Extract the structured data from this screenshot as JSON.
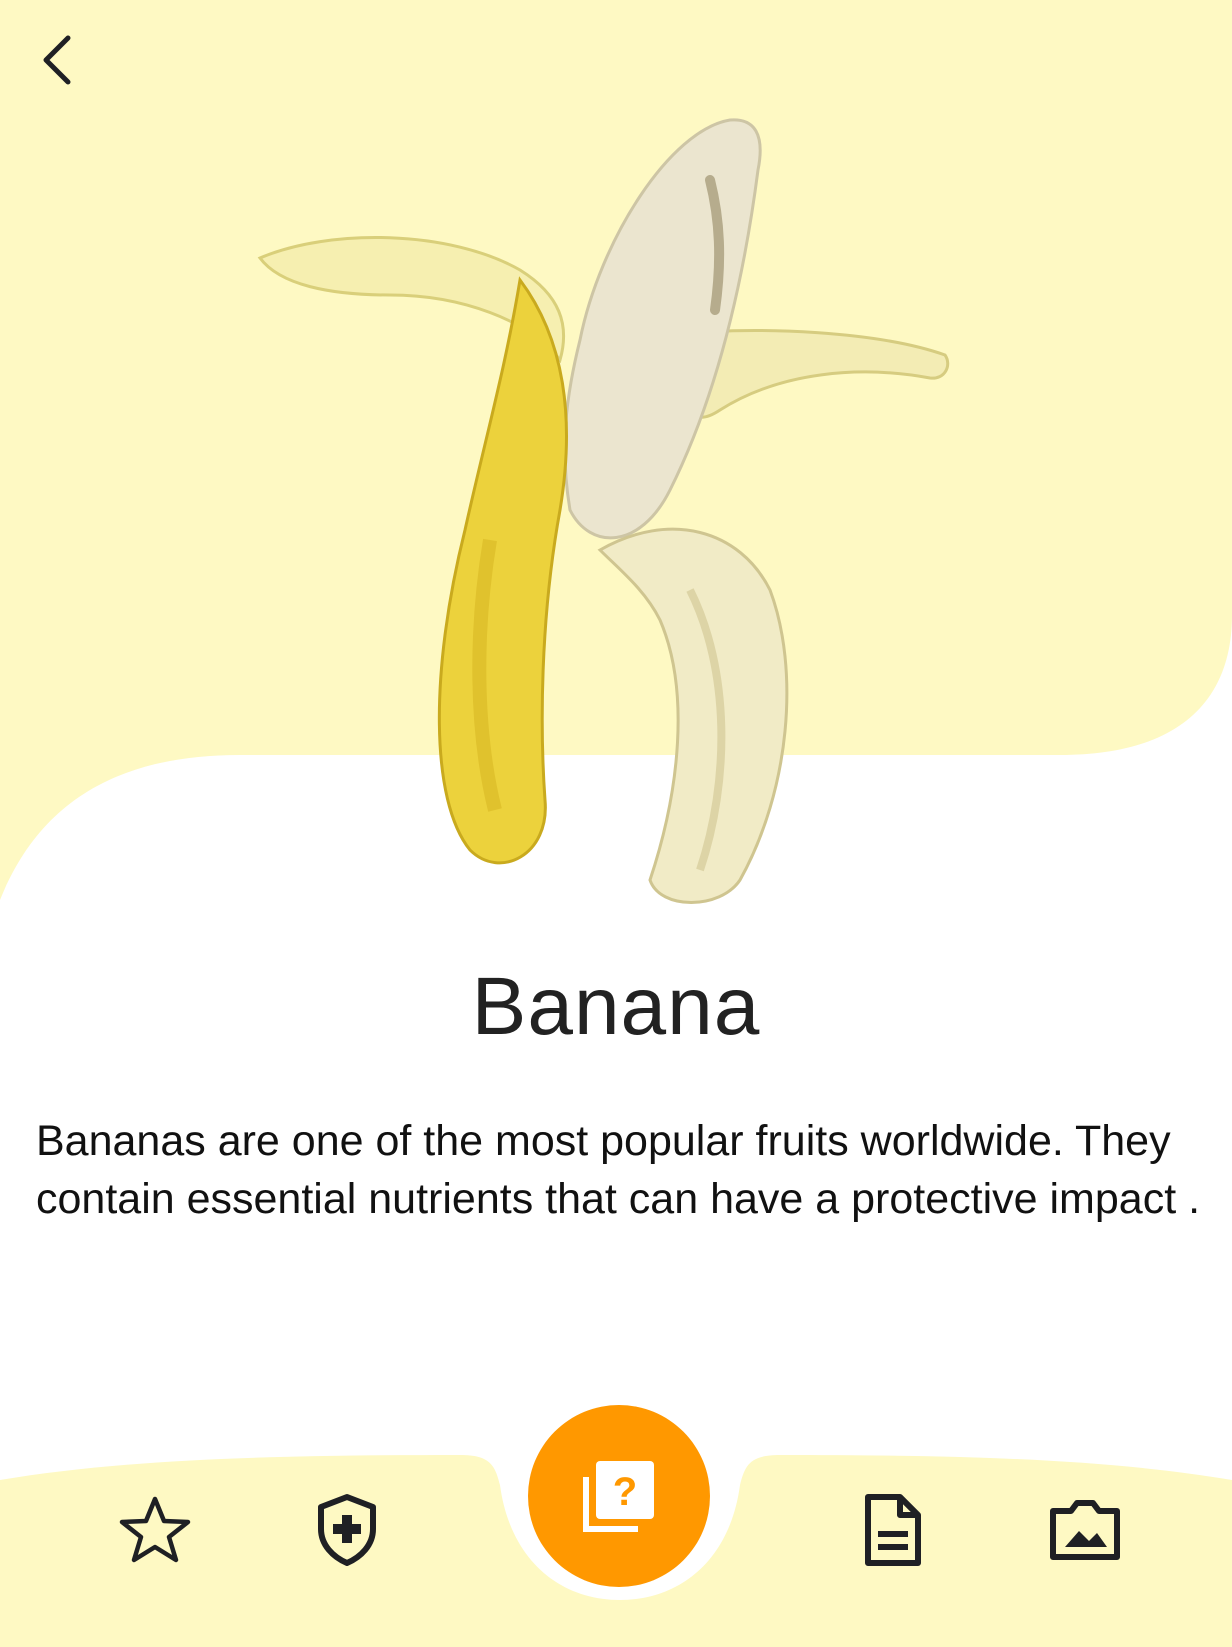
{
  "product": {
    "title": "Banana",
    "description": "Bananas are one of the most popular fruits worldwide. They contain essential nutrients that can have a protective impact ."
  },
  "navigation": {
    "back_icon": "chevron-left-icon"
  },
  "bottom_nav": {
    "items": [
      {
        "icon": "star-icon"
      },
      {
        "icon": "shield-plus-icon"
      },
      {
        "icon": "quiz-cards-icon",
        "primary": true
      },
      {
        "icon": "document-icon"
      },
      {
        "icon": "gallery-icon"
      }
    ]
  },
  "colors": {
    "background_tint": "#fef9c3",
    "accent": "#ff9800",
    "icon": "#1f2024"
  }
}
